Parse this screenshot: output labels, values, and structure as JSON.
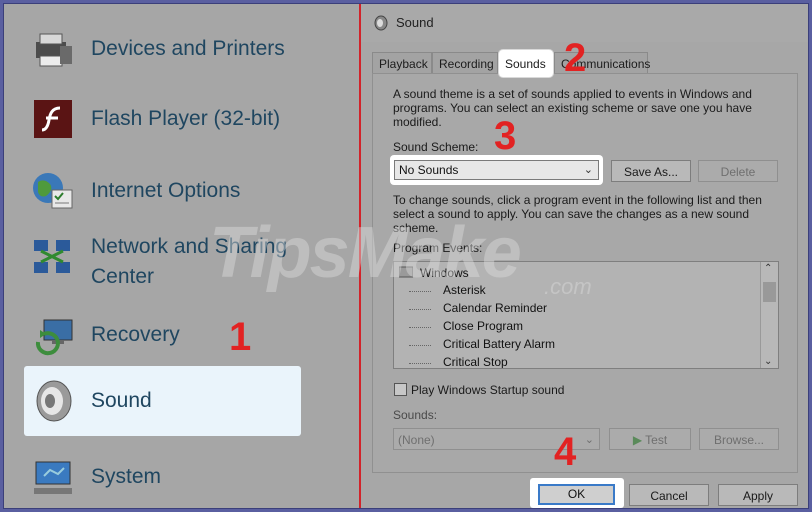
{
  "left_panel": {
    "items": [
      {
        "label": "Devices and Printers",
        "icon": "printer-icon"
      },
      {
        "label": "Flash Player (32-bit)",
        "icon": "flash-icon"
      },
      {
        "label": "Internet Options",
        "icon": "globe-icon"
      },
      {
        "label": "Network and Sharing",
        "label2": "Center",
        "icon": "network-icon"
      },
      {
        "label": "Recovery",
        "icon": "recovery-icon"
      },
      {
        "label": "Sound",
        "icon": "speaker-icon"
      },
      {
        "label": "System",
        "icon": "monitor-icon"
      }
    ]
  },
  "dialog": {
    "title": "Sound",
    "tabs": [
      "Playback",
      "Recording",
      "Sounds",
      "Communications"
    ],
    "active_tab": "Sounds",
    "description": "A sound theme is a set of sounds applied to events in Windows and programs.  You can select an existing scheme or save one you have modified.",
    "scheme_label": "Sound Scheme:",
    "scheme_value": "No Sounds",
    "save_as_label": "Save As...",
    "delete_label": "Delete",
    "change_text": "To change sounds, click a program event in the following list and then select a sound to apply.  You can save the changes as a new sound scheme.",
    "program_events_label": "Program Events:",
    "events_root": "Windows",
    "events": [
      "Asterisk",
      "Calendar Reminder",
      "Close Program",
      "Critical Battery Alarm",
      "Critical Stop"
    ],
    "startup_label": "Play Windows Startup sound",
    "sounds_label": "Sounds:",
    "sounds_value": "(None)",
    "test_label": "Test",
    "browse_label": "Browse...",
    "ok_label": "OK",
    "cancel_label": "Cancel",
    "apply_label": "Apply"
  },
  "steps": [
    "1",
    "2",
    "3",
    "4"
  ],
  "watermark": {
    "main": "TipsMake",
    "sub": ".com"
  },
  "colors": {
    "annotation_red": "#e22222",
    "divider": "#d2232a",
    "selection": "#eaf4fb",
    "label": "#1f4660"
  }
}
